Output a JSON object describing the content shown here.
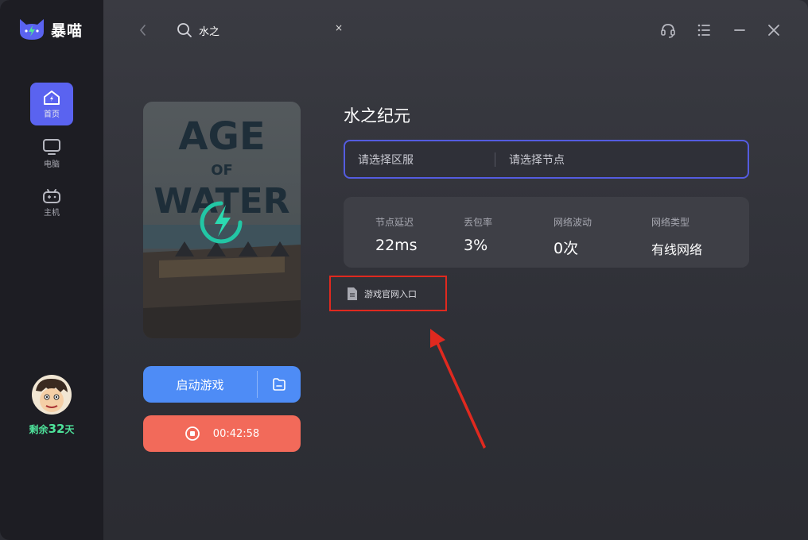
{
  "app": {
    "name": "暴喵"
  },
  "sidebar": {
    "items": [
      {
        "label": "首页",
        "icon": "home-icon",
        "active": true
      },
      {
        "label": "电脑",
        "icon": "monitor-icon",
        "active": false
      },
      {
        "label": "主机",
        "icon": "gamepad-icon",
        "active": false
      }
    ],
    "remain_prefix": "剩余",
    "remain_days": "32",
    "remain_suffix": "天"
  },
  "search": {
    "value": "水之",
    "clear": "×"
  },
  "game": {
    "title": "水之纪元",
    "cover_title_1": "AGE",
    "cover_title_2": "OF",
    "cover_title_3": "WATER"
  },
  "selector": {
    "region_placeholder": "请选择区服",
    "node_placeholder": "请选择节点"
  },
  "stats": [
    {
      "label": "节点延迟",
      "value": "22ms"
    },
    {
      "label": "丢包率",
      "value": "3%"
    },
    {
      "label": "网络波动",
      "value": "0次"
    },
    {
      "label": "网络类型",
      "value": "有线网络"
    }
  ],
  "official_link": {
    "label": "游戏官网入口"
  },
  "buttons": {
    "launch": "启动游戏",
    "stop_timer": "00:42:58"
  },
  "colors": {
    "accent": "#5a63f0",
    "launch": "#4e8cf6",
    "stop": "#f26a5a",
    "highlight": "#e0291f",
    "remain": "#4ee39b"
  }
}
